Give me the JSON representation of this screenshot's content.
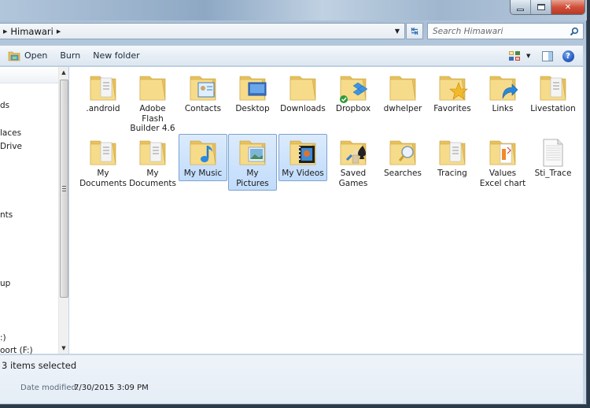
{
  "window": {
    "caption_buttons": {
      "minimize": "minimize",
      "maximize": "maximize",
      "close": "close"
    }
  },
  "address": {
    "breadcrumb": [
      "Himawari"
    ],
    "search_placeholder": "Search Himawari"
  },
  "toolbar": {
    "open_label": "Open",
    "burn_label": "Burn",
    "new_folder_label": "New folder"
  },
  "navpane": {
    "items": [
      {
        "label": "ds"
      },
      {
        "label": "laces"
      },
      {
        "label": "Drive"
      },
      {
        "label": "nts"
      },
      {
        "label": "up"
      },
      {
        "label": ":)"
      },
      {
        "label": "oort (F:)"
      }
    ]
  },
  "content": {
    "items": [
      {
        "label": ".android",
        "icon": "folder-documents-icon",
        "selected": false
      },
      {
        "label": "Adobe Flash Builder 4.6",
        "icon": "folder-icon",
        "selected": false
      },
      {
        "label": "Contacts",
        "icon": "folder-contacts-icon",
        "selected": false
      },
      {
        "label": "Desktop",
        "icon": "folder-desktop-icon",
        "selected": false
      },
      {
        "label": "Downloads",
        "icon": "folder-icon",
        "selected": false
      },
      {
        "label": "Dropbox",
        "icon": "folder-dropbox-icon",
        "selected": false
      },
      {
        "label": "dwhelper",
        "icon": "folder-icon",
        "selected": false
      },
      {
        "label": "Favorites",
        "icon": "folder-favorites-icon",
        "selected": false
      },
      {
        "label": "Links",
        "icon": "folder-links-icon",
        "selected": false
      },
      {
        "label": "Livestation",
        "icon": "folder-documents-icon",
        "selected": false
      },
      {
        "label": "My Documents",
        "icon": "folder-documents-icon",
        "selected": false
      },
      {
        "label": "My Documents",
        "icon": "folder-documents-icon",
        "selected": false
      },
      {
        "label": "My Music",
        "icon": "folder-music-icon",
        "selected": true
      },
      {
        "label": "My Pictures",
        "icon": "folder-pictures-icon",
        "selected": true
      },
      {
        "label": "My Videos",
        "icon": "folder-videos-icon",
        "selected": true
      },
      {
        "label": "Saved Games",
        "icon": "folder-games-icon",
        "selected": false
      },
      {
        "label": "Searches",
        "icon": "folder-searches-icon",
        "selected": false
      },
      {
        "label": "Tracing",
        "icon": "folder-documents-icon",
        "selected": false
      },
      {
        "label": "Values Excel chart",
        "icon": "folder-excel-icon",
        "selected": false
      },
      {
        "label": "Sti_Trace",
        "icon": "text-file-icon",
        "selected": false
      }
    ]
  },
  "details": {
    "selection_count": "3 items selected",
    "date_modified_label": "Date modified:",
    "date_modified_value": "7/30/2015 3:09 PM"
  },
  "colors": {
    "selection_fill": "#c9e0fc",
    "selection_border": "#7da2ce",
    "folder": "#f2d27a",
    "close_button": "#c9432d"
  }
}
